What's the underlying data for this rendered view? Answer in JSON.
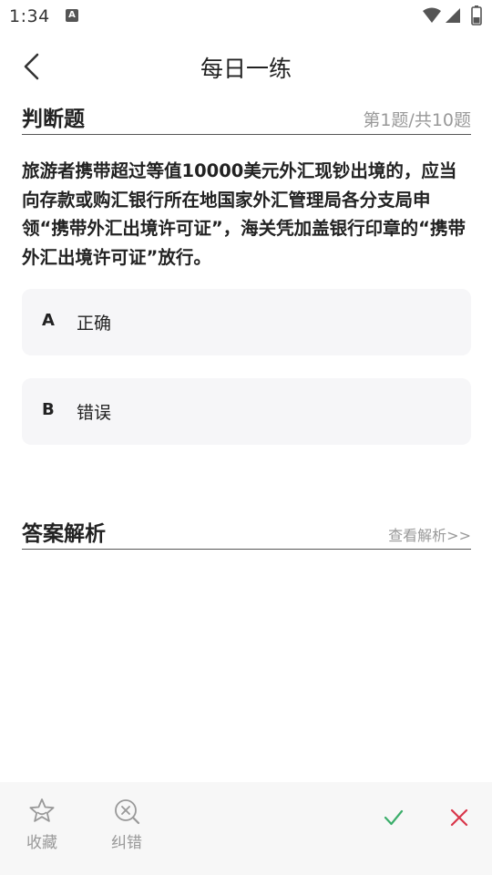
{
  "status_bar": {
    "time": "1:34",
    "notification_icon": "A",
    "icons": [
      "wifi-icon",
      "signal-icon",
      "battery-icon"
    ]
  },
  "header": {
    "title": "每日一练",
    "back_icon": "chevron-left-icon"
  },
  "question_section": {
    "type_label": "判断题",
    "progress": "第1题/共10题"
  },
  "question": {
    "text": "旅游者携带超过等值10000美元外汇现钞出境的，应当向存款或购汇银行所在地国家外汇管理局各分支局申领“携带外汇出境许可证”，海关凭加盖银行印章的“携带外汇出境许可证”放行。"
  },
  "options": [
    {
      "letter": "A",
      "text": "正确"
    },
    {
      "letter": "B",
      "text": "错误"
    }
  ],
  "analysis_section": {
    "title": "答案解析",
    "link": "查看解析>>"
  },
  "bottom_bar": {
    "favorite_label": "收藏",
    "report_label": "纠错",
    "favorite_icon": "star-icon",
    "report_icon": "magnify-x-icon",
    "correct_icon": "check-icon",
    "wrong_icon": "cross-icon",
    "colors": {
      "check": "#3cae6b",
      "cross": "#d9364a",
      "muted": "#999999"
    }
  }
}
